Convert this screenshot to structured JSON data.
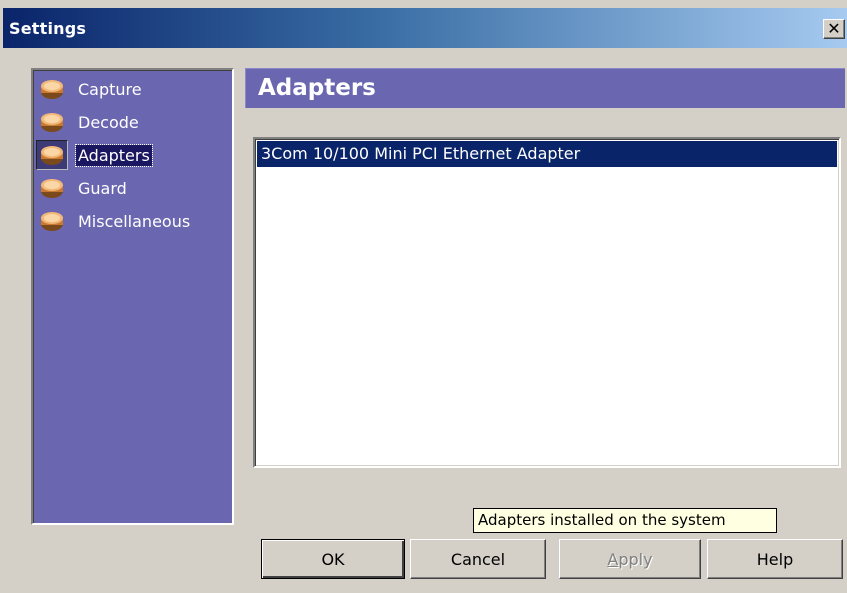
{
  "window": {
    "title": "Settings",
    "close_glyph": "✕"
  },
  "nav": {
    "items": [
      {
        "label": "Capture",
        "icon": "box-icon"
      },
      {
        "label": "Decode",
        "icon": "box-icon"
      },
      {
        "label": "Adapters",
        "icon": "box-icon",
        "selected": true
      },
      {
        "label": "Guard",
        "icon": "box-icon"
      },
      {
        "label": "Miscellaneous",
        "icon": "box-icon"
      }
    ]
  },
  "content": {
    "header": "Adapters",
    "adapters": [
      {
        "name": "3Com 10/100 Mini PCI Ethernet Adapter",
        "selected": true
      }
    ],
    "tooltip": "Adapters installed on the system"
  },
  "buttons": {
    "ok": "OK",
    "cancel": "Cancel",
    "apply": "Apply",
    "help": "Help"
  },
  "colors": {
    "nav_background": "#6a67b0",
    "selection": "#0a246a",
    "tooltip_background": "#ffffe1"
  }
}
